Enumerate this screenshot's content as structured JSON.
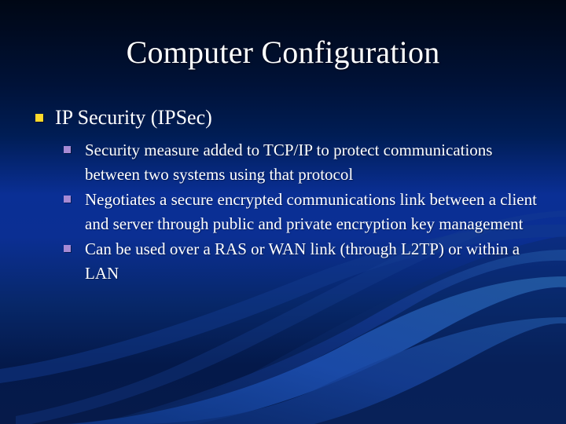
{
  "slide": {
    "title": "Computer Configuration",
    "background": {
      "style": "blue-gradient-with-curved-ribbons",
      "top_color": "#000715",
      "mid_color": "#0a2f95",
      "bottom_color": "#061a4a",
      "ribbon_color": "#1a4ba8",
      "ribbon_color_dark": "#123a86"
    },
    "title_color": "#ffffff",
    "body_text_color": "#ffffff",
    "bullets": [
      {
        "level": 1,
        "marker": "gold-square-bullet",
        "marker_color": "#ffd92b",
        "text": "IP Security (IPSec)",
        "children": [
          {
            "level": 2,
            "marker": "purple-square-bullet",
            "marker_color": "#a78ad4",
            "text": "Security measure added to TCP/IP to protect communications between two systems using that protocol"
          },
          {
            "level": 2,
            "marker": "purple-square-bullet",
            "marker_color": "#a78ad4",
            "text": "Negotiates a secure encrypted communications link between a client and server through public and private encryption key management"
          },
          {
            "level": 2,
            "marker": "purple-square-bullet",
            "marker_color": "#a78ad4",
            "text": "Can be used over a RAS or WAN link (through L2TP) or within a LAN"
          }
        ]
      }
    ]
  }
}
